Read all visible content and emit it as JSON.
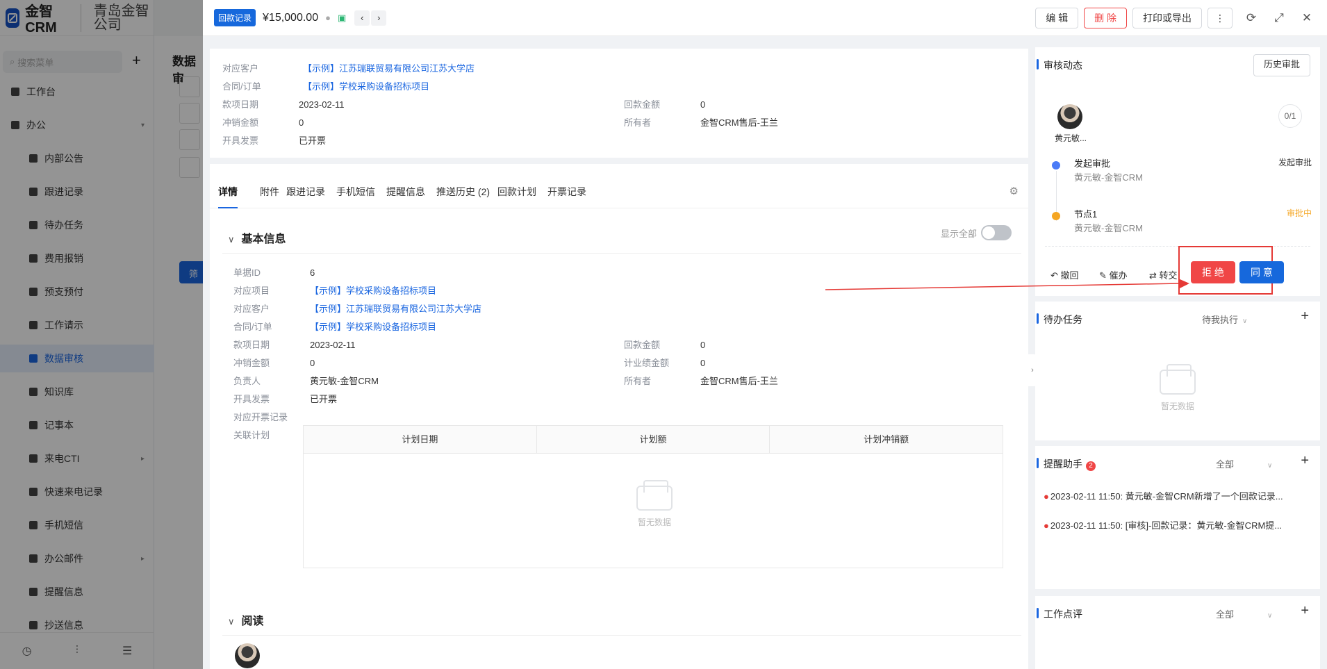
{
  "app": {
    "brand": "金智CRM",
    "company": "青岛金智公司",
    "search_placeholder": "搜索菜单",
    "menu": [
      {
        "label": "工作台",
        "level": "top"
      },
      {
        "label": "办公",
        "level": "top",
        "expanded": true
      },
      {
        "label": "内部公告",
        "level": "sub"
      },
      {
        "label": "跟进记录",
        "level": "sub"
      },
      {
        "label": "待办任务",
        "level": "sub"
      },
      {
        "label": "费用报销",
        "level": "sub"
      },
      {
        "label": "预支预付",
        "level": "sub"
      },
      {
        "label": "工作请示",
        "level": "sub"
      },
      {
        "label": "数据审核",
        "level": "sub",
        "active": true
      },
      {
        "label": "知识库",
        "level": "sub"
      },
      {
        "label": "记事本",
        "level": "sub"
      },
      {
        "label": "来电CTI",
        "level": "sub",
        "has_children": true
      },
      {
        "label": "快速来电记录",
        "level": "sub"
      },
      {
        "label": "手机短信",
        "level": "sub"
      },
      {
        "label": "办公邮件",
        "level": "sub",
        "has_children": true
      },
      {
        "label": "提醒信息",
        "level": "sub"
      },
      {
        "label": "抄送信息",
        "level": "sub"
      }
    ],
    "background_page_title": "数据审",
    "background_filter_button": "筛"
  },
  "drawer": {
    "header": {
      "record_type_tag": "回款记录",
      "amount": "¥15,000.00",
      "edit_label": "编 辑",
      "delete_label": "删 除",
      "print_label": "打印或导出"
    },
    "summary": {
      "customer_label": "对应客户",
      "customer_value": "【示例】江苏瑞联贸易有限公司江苏大学店",
      "contract_label": "合同/订单",
      "contract_value": "【示例】学校采购设备招标项目",
      "date_label": "款项日期",
      "date_value": "2023-02-11",
      "payment_amount_label": "回款金额",
      "payment_amount_value": "0",
      "writeoff_label": "冲销金额",
      "writeoff_value": "0",
      "owner_label": "所有者",
      "owner_value": "金智CRM售后-王兰",
      "invoice_label": "开具发票",
      "invoice_value": "已开票"
    },
    "tabs": [
      "详情",
      "附件",
      "跟进记录",
      "手机短信",
      "提醒信息",
      "推送历史 (2)",
      "回款计划",
      "开票记录"
    ],
    "basic_info": {
      "title": "基本信息",
      "show_all_label": "显示全部",
      "id_label": "单据ID",
      "id_value": "6",
      "project_label": "对应项目",
      "project_value": "【示例】学校采购设备招标项目",
      "customer_label": "对应客户",
      "customer_value": "【示例】江苏瑞联贸易有限公司江苏大学店",
      "contract_label": "合同/订单",
      "contract_value": "【示例】学校采购设备招标项目",
      "date_label": "款项日期",
      "date_value": "2023-02-11",
      "payment_amount_label": "回款金额",
      "payment_amount_value": "0",
      "writeoff_label": "冲销金额",
      "writeoff_value": "0",
      "performance_label": "计业绩金额",
      "performance_value": "0",
      "responsible_label": "负责人",
      "responsible_value": "黄元敏-金智CRM",
      "owner_label": "所有者",
      "owner_value": "金智CRM售后-王兰",
      "invoice_label": "开具发票",
      "invoice_value": "已开票",
      "invoice_record_label": "对应开票记录",
      "plan_label": "关联计划",
      "plan_columns": [
        "计划日期",
        "计划额",
        "计划冲销额"
      ],
      "empty_text": "暂无数据"
    },
    "read_section": {
      "title": "阅读"
    }
  },
  "right_panel": {
    "audit": {
      "title": "审核动态",
      "history_button": "历史审批",
      "approver_name": "黄元敏...",
      "progress": "0/1",
      "steps": [
        {
          "title": "发起审批",
          "user": "黄元敏-金智CRM",
          "status": "发起审批",
          "status_color": "#333333",
          "dot_color": "#4a7bf7"
        },
        {
          "title": "节点1",
          "user": "黄元敏-金智CRM",
          "status": "审批中",
          "status_color": "#f5a623",
          "dot_color": "#f5a623"
        }
      ],
      "withdraw_label": "撤回",
      "urge_label": "催办",
      "transfer_label": "转交",
      "reject_label": "拒 绝",
      "approve_label": "同 意",
      "reject_color": "#f04646",
      "approve_color": "#1668dc"
    },
    "tasks": {
      "title": "待办任务",
      "filter": "待我执行",
      "empty_text": "暂无数据"
    },
    "reminder": {
      "title": "提醒助手",
      "count": "2",
      "filter": "全部",
      "items": [
        "2023-02-11 11:50: 黄元敏-金智CRM新增了一个回款记录...",
        "2023-02-11 11:50: [审核]-回款记录：黄元敏-金智CRM提..."
      ]
    },
    "review": {
      "title": "工作点评",
      "filter": "全部"
    }
  }
}
